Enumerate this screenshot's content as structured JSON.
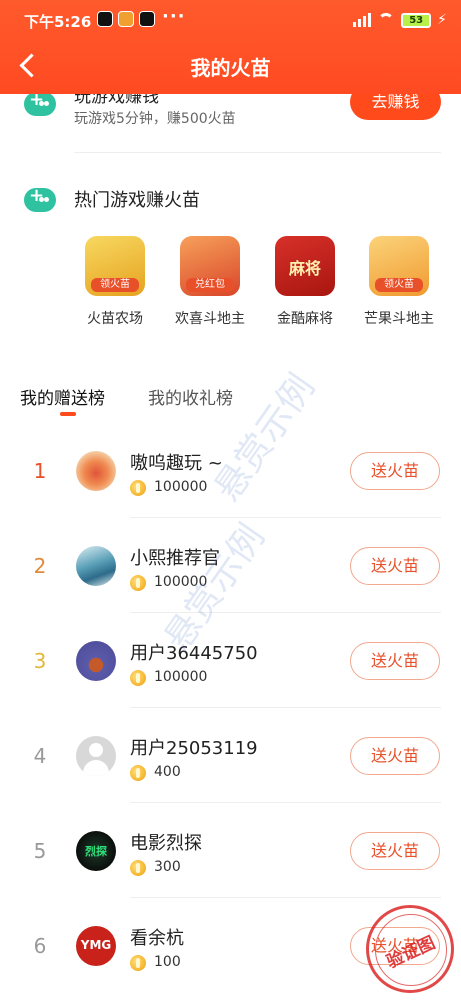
{
  "status_bar": {
    "time": "下午5:26",
    "extra": "···",
    "battery": "53",
    "icons": [
      "tiktok-icon",
      "app-icon",
      "tiktok-icon",
      "signal-icon",
      "wifi-icon",
      "battery-icon",
      "charging-icon"
    ]
  },
  "nav": {
    "title": "我的火苗",
    "back_icon": "back-arrow-icon"
  },
  "earn": {
    "title": "玩游戏赚钱",
    "subtitle": "玩游戏5分钟，赚500火苗",
    "button": "去赚钱"
  },
  "hot_games": {
    "title": "热门游戏赚火苗",
    "items": [
      {
        "label": "火苗农场",
        "badge": "领火苗",
        "color": "#f2c84b"
      },
      {
        "label": "欢喜斗地主",
        "badge": "兑红包",
        "color": "#f06a3a"
      },
      {
        "label": "金酷麻将",
        "badge": "麻将",
        "color": "#c8221b"
      },
      {
        "label": "芒果斗地主",
        "badge": "领火苗",
        "color": "#f5b23e"
      }
    ]
  },
  "tabs": [
    {
      "label": "我的赠送榜",
      "active": true
    },
    {
      "label": "我的收礼榜",
      "active": false
    }
  ],
  "leaderboard": [
    {
      "rank": "1",
      "name": "嗷呜趣玩 ~",
      "amount": "100000",
      "button": "送火苗",
      "rank_color": "#e8502a"
    },
    {
      "rank": "2",
      "name": "小熙推荐官",
      "amount": "100000",
      "button": "送火苗",
      "rank_color": "#e08a3a"
    },
    {
      "rank": "3",
      "name": "用户36445750",
      "amount": "100000",
      "button": "送火苗",
      "rank_color": "#e2b73a"
    },
    {
      "rank": "4",
      "name": "用户25053119",
      "amount": "400",
      "button": "送火苗",
      "rank_color": "#999999"
    },
    {
      "rank": "5",
      "name": "电影烈探",
      "amount": "300",
      "button": "送火苗",
      "rank_color": "#999999"
    },
    {
      "rank": "6",
      "name": "看余杭",
      "amount": "100",
      "button": "送火苗",
      "rank_color": "#999999"
    }
  ],
  "avatar_texts": {
    "row6": "YMG",
    "row5": "烈探"
  },
  "watermark": {
    "text1": "悬赏示例",
    "text2": "悬赏示例",
    "stamp": "验证图"
  },
  "colors": {
    "header": "#ff4a22",
    "accent": "#ff4a1c",
    "button_border": "#f1a88e",
    "button_text": "#e8502a",
    "game_icon": "#2fc2a0"
  }
}
